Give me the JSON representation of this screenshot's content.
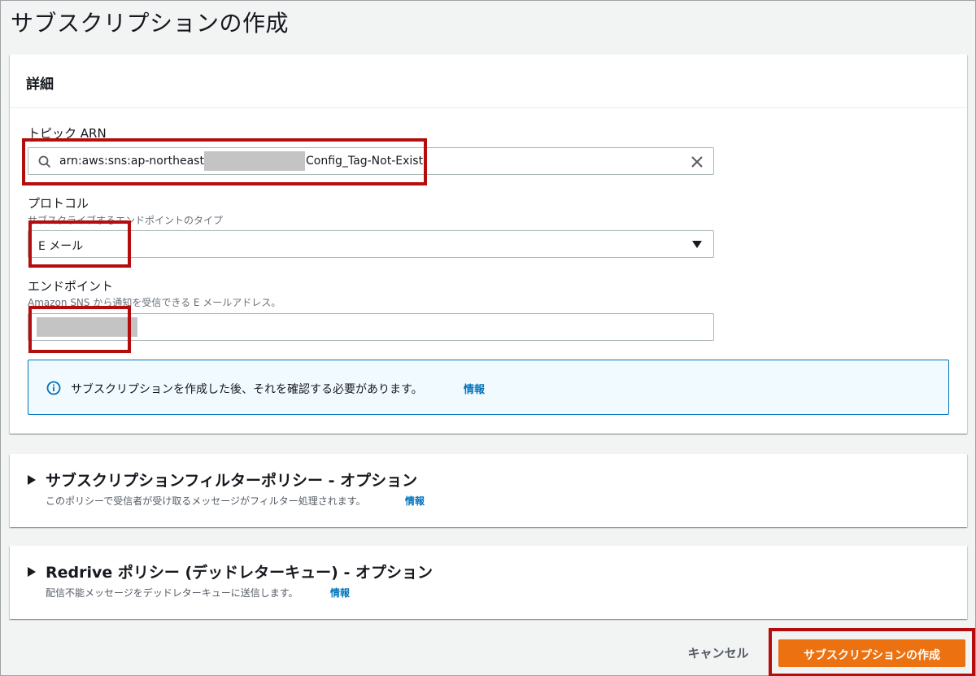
{
  "page": {
    "title": "サブスクリプションの作成"
  },
  "details": {
    "header": "詳細",
    "topic_arn": {
      "label": "トピック ARN",
      "value_prefix": "arn:aws:sns:ap-northeast-",
      "value_suffix": "Config_Tag-Not-Exist"
    },
    "protocol": {
      "label": "プロトコル",
      "description": "サブスクライブするエンドポイントのタイプ",
      "value": "E メール"
    },
    "endpoint": {
      "label": "エンドポイント",
      "description": "Amazon SNS から通知を受信できる E メールアドレス。"
    },
    "alert": {
      "text": "サブスクリプションを作成した後、それを確認する必要があります。",
      "link": "情報"
    }
  },
  "filter_policy": {
    "title": "サブスクリプションフィルターポリシー - オプション",
    "description": "このポリシーで受信者が受け取るメッセージがフィルター処理されます。",
    "link": "情報"
  },
  "redrive_policy": {
    "title": "Redrive ポリシー (デッドレターキュー) - オプション",
    "description": "配信不能メッセージをデッドレターキューに送信します。",
    "link": "情報"
  },
  "footer": {
    "cancel_label": "キャンセル",
    "create_label": "サブスクリプションの作成"
  },
  "colors": {
    "accent": "#ec7211",
    "link": "#0073bb",
    "highlight": "#b30d0d",
    "redaction": "#c4c4c4"
  },
  "icons": [
    "search-icon",
    "clear-icon",
    "caret-down-icon",
    "info-icon",
    "expand-triangle-icon"
  ]
}
